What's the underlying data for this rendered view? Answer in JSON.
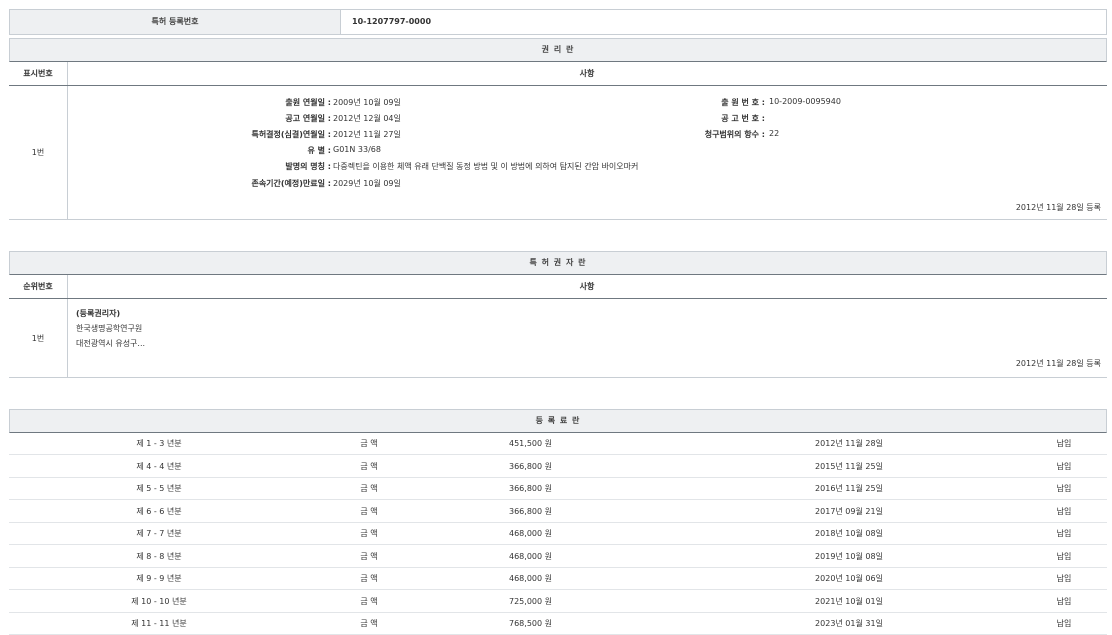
{
  "registration": {
    "label": "특허 등록번호",
    "value": "10-1207797-0000"
  },
  "rights": {
    "title": "권 리 란",
    "col1": "표시번호",
    "col2": "사항",
    "row": {
      "no": "1번",
      "left": [
        {
          "k": "출원 연월일 :",
          "v": "2009년 10월 09일"
        },
        {
          "k": "공고 연월일 :",
          "v": "2012년 12월 04일"
        },
        {
          "k": "특허결정(심결)연월일 :",
          "v": "2012년 11월 27일"
        },
        {
          "k": "유 별 :",
          "v": "G01N 33/68"
        },
        {
          "k": "발명의 명칭 :",
          "v": "다중렉틴을 이용한 체액 유래 단백질 동정 방법 및 이 방법에 의하여 탐지된 간암 바이오마커"
        },
        {
          "k": "존속기간(예정)만료일 :",
          "v": "2029년 10월 09일"
        }
      ],
      "right": [
        {
          "k": "출 원 번 호 :",
          "v": "10-2009-0095940"
        },
        {
          "k": "공 고 번 호 :",
          "v": ""
        },
        {
          "k": "청구범위의 항수 :",
          "v": "22"
        }
      ],
      "stamp": "2012년 11월 28일 등록"
    }
  },
  "holders": {
    "title": "특 허 권 자 란",
    "col1": "순위번호",
    "col2": "사항",
    "row": {
      "no": "1번",
      "lines": [
        "(등록권리자)",
        "한국생명공학연구원",
        "대전광역시 유성구..."
      ],
      "stamp": "2012년 11월 28일 등록"
    }
  },
  "fees": {
    "title": "등 록 료 란",
    "rows": [
      {
        "period": "제 1 - 3 년분",
        "label": "금 액",
        "amount": "451,500 원",
        "date": "2012년 11월 28일",
        "status": "납입"
      },
      {
        "period": "제 4 - 4 년분",
        "label": "금 액",
        "amount": "366,800 원",
        "date": "2015년 11월 25일",
        "status": "납입"
      },
      {
        "period": "제 5 - 5 년분",
        "label": "금 액",
        "amount": "366,800 원",
        "date": "2016년 11월 25일",
        "status": "납입"
      },
      {
        "period": "제 6 - 6 년분",
        "label": "금 액",
        "amount": "366,800 원",
        "date": "2017년 09월 21일",
        "status": "납입"
      },
      {
        "period": "제 7 - 7 년분",
        "label": "금 액",
        "amount": "468,000 원",
        "date": "2018년 10월 08일",
        "status": "납입"
      },
      {
        "period": "제 8 - 8 년분",
        "label": "금 액",
        "amount": "468,000 원",
        "date": "2019년 10월 08일",
        "status": "납입"
      },
      {
        "period": "제 9 - 9 년분",
        "label": "금 액",
        "amount": "468,000 원",
        "date": "2020년 10월 06일",
        "status": "납입"
      },
      {
        "period": "제 10 - 10 년분",
        "label": "금 액",
        "amount": "725,000 원",
        "date": "2021년 10월 01일",
        "status": "납입"
      },
      {
        "period": "제 11 - 11 년분",
        "label": "금 액",
        "amount": "768,500 원",
        "date": "2023년 01월 31일",
        "status": "납입"
      }
    ]
  }
}
